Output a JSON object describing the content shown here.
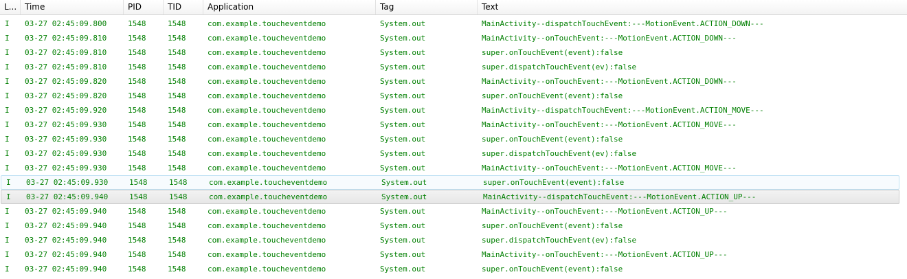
{
  "columns": [
    {
      "key": "level",
      "label": "L..."
    },
    {
      "key": "time",
      "label": "Time"
    },
    {
      "key": "pid",
      "label": "PID"
    },
    {
      "key": "tid",
      "label": "TID"
    },
    {
      "key": "app",
      "label": "Application"
    },
    {
      "key": "tag",
      "label": "Tag"
    },
    {
      "key": "text",
      "label": "Text"
    }
  ],
  "colors": {
    "log_text": "#007f00",
    "hover_border": "#bfe1f4",
    "selected_border": "#c9c9c9"
  },
  "rows": [
    {
      "level": "I",
      "time": "03-27 02:45:09.800",
      "pid": "1548",
      "tid": "1548",
      "app": "com.example.toucheventdemo",
      "tag": "System.out",
      "text": "MainActivity--dispatchTouchEvent:---MotionEvent.ACTION_DOWN---",
      "state": ""
    },
    {
      "level": "I",
      "time": "03-27 02:45:09.810",
      "pid": "1548",
      "tid": "1548",
      "app": "com.example.toucheventdemo",
      "tag": "System.out",
      "text": "MainActivity--onTouchEvent:---MotionEvent.ACTION_DOWN---",
      "state": ""
    },
    {
      "level": "I",
      "time": "03-27 02:45:09.810",
      "pid": "1548",
      "tid": "1548",
      "app": "com.example.toucheventdemo",
      "tag": "System.out",
      "text": "super.onTouchEvent(event):false",
      "state": ""
    },
    {
      "level": "I",
      "time": "03-27 02:45:09.810",
      "pid": "1548",
      "tid": "1548",
      "app": "com.example.toucheventdemo",
      "tag": "System.out",
      "text": "super.dispatchTouchEvent(ev):false",
      "state": ""
    },
    {
      "level": "I",
      "time": "03-27 02:45:09.820",
      "pid": "1548",
      "tid": "1548",
      "app": "com.example.toucheventdemo",
      "tag": "System.out",
      "text": "MainActivity--onTouchEvent:---MotionEvent.ACTION_DOWN---",
      "state": ""
    },
    {
      "level": "I",
      "time": "03-27 02:45:09.820",
      "pid": "1548",
      "tid": "1548",
      "app": "com.example.toucheventdemo",
      "tag": "System.out",
      "text": "super.onTouchEvent(event):false",
      "state": ""
    },
    {
      "level": "I",
      "time": "03-27 02:45:09.920",
      "pid": "1548",
      "tid": "1548",
      "app": "com.example.toucheventdemo",
      "tag": "System.out",
      "text": "MainActivity--dispatchTouchEvent:---MotionEvent.ACTION_MOVE---",
      "state": ""
    },
    {
      "level": "I",
      "time": "03-27 02:45:09.930",
      "pid": "1548",
      "tid": "1548",
      "app": "com.example.toucheventdemo",
      "tag": "System.out",
      "text": "MainActivity--onTouchEvent:---MotionEvent.ACTION_MOVE---",
      "state": ""
    },
    {
      "level": "I",
      "time": "03-27 02:45:09.930",
      "pid": "1548",
      "tid": "1548",
      "app": "com.example.toucheventdemo",
      "tag": "System.out",
      "text": "super.onTouchEvent(event):false",
      "state": ""
    },
    {
      "level": "I",
      "time": "03-27 02:45:09.930",
      "pid": "1548",
      "tid": "1548",
      "app": "com.example.toucheventdemo",
      "tag": "System.out",
      "text": "super.dispatchTouchEvent(ev):false",
      "state": ""
    },
    {
      "level": "I",
      "time": "03-27 02:45:09.930",
      "pid": "1548",
      "tid": "1548",
      "app": "com.example.toucheventdemo",
      "tag": "System.out",
      "text": "MainActivity--onTouchEvent:---MotionEvent.ACTION_MOVE---",
      "state": ""
    },
    {
      "level": "I",
      "time": "03-27 02:45:09.930",
      "pid": "1548",
      "tid": "1548",
      "app": "com.example.toucheventdemo",
      "tag": "System.out",
      "text": "super.onTouchEvent(event):false",
      "state": "hover"
    },
    {
      "level": "I",
      "time": "03-27 02:45:09.940",
      "pid": "1548",
      "tid": "1548",
      "app": "com.example.toucheventdemo",
      "tag": "System.out",
      "text": "MainActivity--dispatchTouchEvent:---MotionEvent.ACTION_UP---",
      "state": "selected"
    },
    {
      "level": "I",
      "time": "03-27 02:45:09.940",
      "pid": "1548",
      "tid": "1548",
      "app": "com.example.toucheventdemo",
      "tag": "System.out",
      "text": "MainActivity--onTouchEvent:---MotionEvent.ACTION_UP---",
      "state": ""
    },
    {
      "level": "I",
      "time": "03-27 02:45:09.940",
      "pid": "1548",
      "tid": "1548",
      "app": "com.example.toucheventdemo",
      "tag": "System.out",
      "text": "super.onTouchEvent(event):false",
      "state": ""
    },
    {
      "level": "I",
      "time": "03-27 02:45:09.940",
      "pid": "1548",
      "tid": "1548",
      "app": "com.example.toucheventdemo",
      "tag": "System.out",
      "text": "super.dispatchTouchEvent(ev):false",
      "state": ""
    },
    {
      "level": "I",
      "time": "03-27 02:45:09.940",
      "pid": "1548",
      "tid": "1548",
      "app": "com.example.toucheventdemo",
      "tag": "System.out",
      "text": "MainActivity--onTouchEvent:---MotionEvent.ACTION_UP---",
      "state": ""
    },
    {
      "level": "I",
      "time": "03-27 02:45:09.940",
      "pid": "1548",
      "tid": "1548",
      "app": "com.example.toucheventdemo",
      "tag": "System.out",
      "text": "super.onTouchEvent(event):false",
      "state": ""
    }
  ]
}
